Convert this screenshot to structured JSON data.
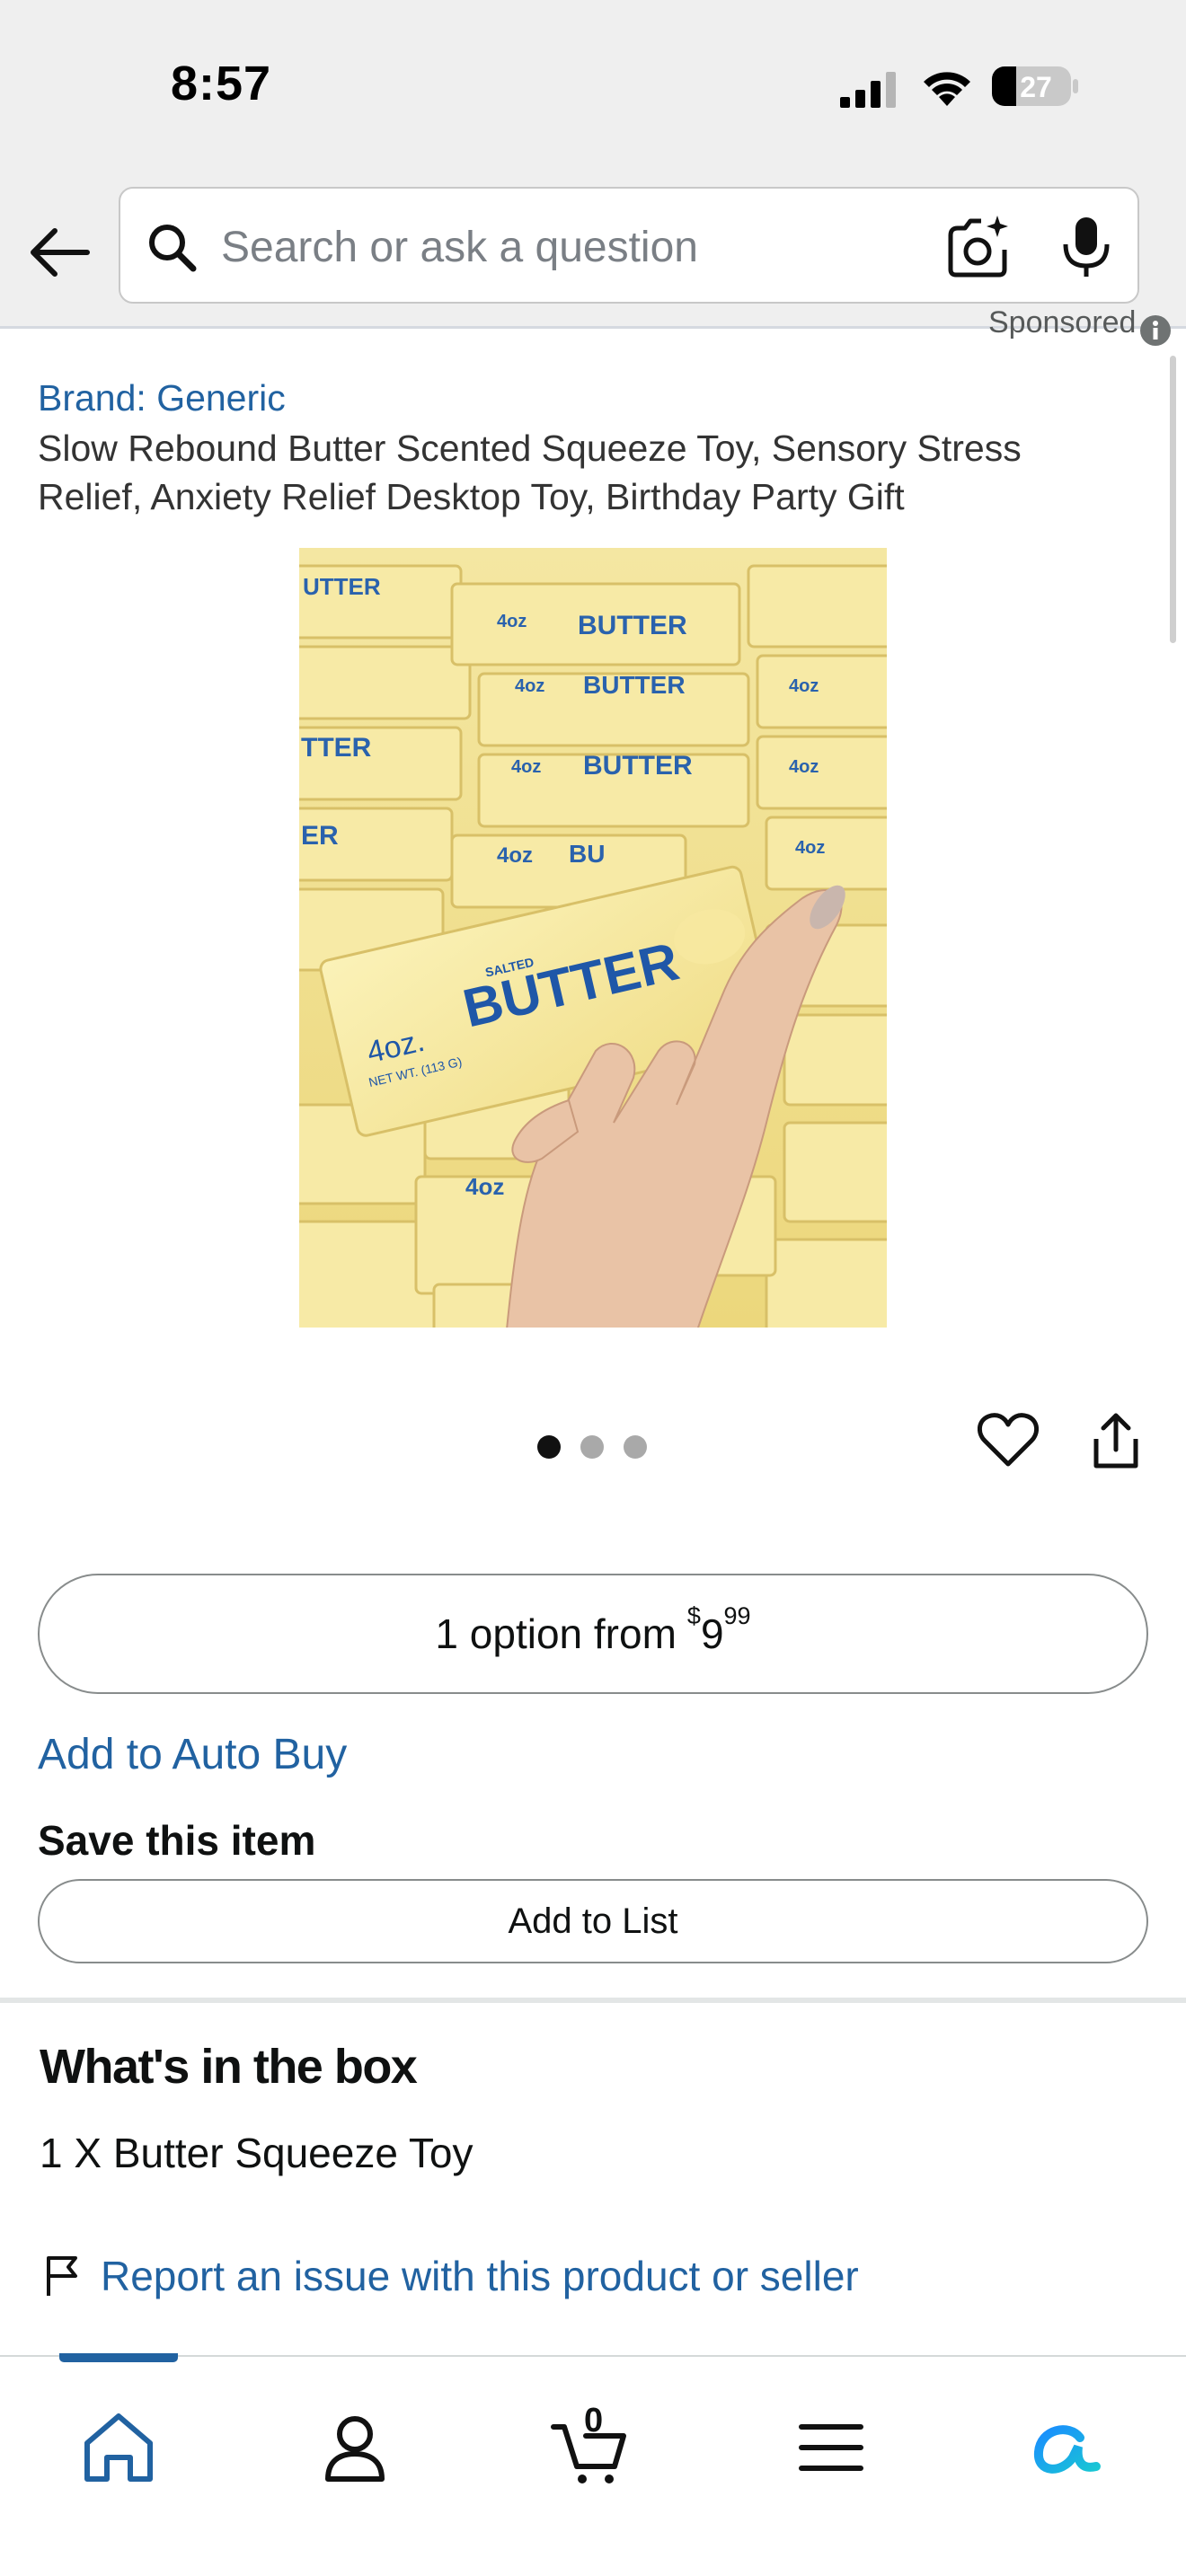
{
  "status_bar": {
    "time": "8:57",
    "battery_level": "27",
    "icons": [
      "signal-icon",
      "wifi-icon",
      "battery-icon"
    ]
  },
  "header": {
    "search_placeholder": "Search or ask a question",
    "icons": [
      "back-arrow-icon",
      "search-icon",
      "camera-icon",
      "mic-icon"
    ]
  },
  "product": {
    "sponsored_label": "Sponsored",
    "brand": "Brand: Generic",
    "title": "Slow Rebound Butter Scented Squeeze Toy, Sensory Stress Relief, Anxiety Relief Desktop Toy, Birthday Party Gift",
    "image": {
      "main_label": "BUTTER",
      "salted_label": "SALTED",
      "size_label": "4oz.",
      "net_wt_label": "NET WT. (113 G)"
    },
    "carousel": {
      "count": 3,
      "active": 0
    }
  },
  "buy_box": {
    "options_text": "1 option from",
    "price_currency": "$",
    "price_whole": "9",
    "price_fraction": "99",
    "auto_buy_label": "Add to Auto Buy",
    "save_heading": "Save this item",
    "add_to_list_label": "Add to List"
  },
  "whats_in_box": {
    "heading": "What's in the box",
    "contents": "1 X Butter Squeeze Toy"
  },
  "report": {
    "label": "Report an issue with this product or seller"
  },
  "bottom_nav": {
    "cart_count": "0",
    "active": "home",
    "items": [
      "home-icon",
      "account-icon",
      "cart-icon",
      "menu-icon",
      "rufus-icon"
    ]
  },
  "colors": {
    "link": "#2162a1",
    "status_bg": "#efefef",
    "butter": "#f3e38a",
    "butter_text": "#1f57a8"
  }
}
